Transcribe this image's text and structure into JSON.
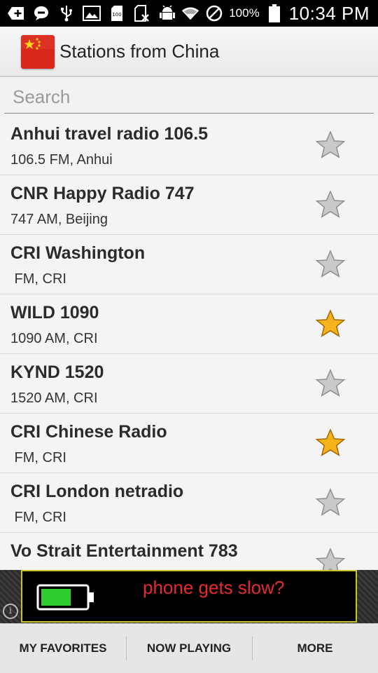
{
  "status_bar": {
    "battery_percent": "100%",
    "time": "10:34 PM",
    "icons": [
      "add-icon",
      "chat-icon",
      "usb-icon",
      "image-icon",
      "sd-card-icon",
      "no-sim-icon",
      "android-debug-icon",
      "wifi-icon",
      "do-not-disturb-icon",
      "battery-icon"
    ]
  },
  "header": {
    "title": "Stations from China",
    "icon": "china-flag-icon"
  },
  "search": {
    "placeholder": "Search",
    "value": ""
  },
  "stations": [
    {
      "name": "Anhui travel radio 106.5",
      "subtitle": "106.5 FM, Anhui",
      "favorite": false
    },
    {
      "name": "CNR Happy Radio 747",
      "subtitle": "747 AM, Beijing",
      "favorite": false
    },
    {
      "name": "CRI Washington",
      "subtitle": " FM, CRI",
      "favorite": false
    },
    {
      "name": "WILD 1090",
      "subtitle": "1090 AM, CRI",
      "favorite": true
    },
    {
      "name": "KYND 1520",
      "subtitle": "1520 AM, CRI",
      "favorite": false
    },
    {
      "name": "CRI Chinese Radio",
      "subtitle": " FM, CRI",
      "favorite": true
    },
    {
      "name": "CRI London netradio",
      "subtitle": " FM, CRI",
      "favorite": false
    },
    {
      "name": "Vo Strait Entertainment 783",
      "subtitle": "",
      "favorite": false
    }
  ],
  "ad": {
    "text": "phone gets slow?",
    "text_color": "#e52b2b",
    "border_color": "#c8c42c"
  },
  "bottom_bar": {
    "favorites_label": "MY FAVORITES",
    "now_playing_label": "NOW PLAYING",
    "more_label": "MORE"
  },
  "colors": {
    "star_gold": "#f5b21a",
    "star_gray": "#c9c9c9"
  }
}
